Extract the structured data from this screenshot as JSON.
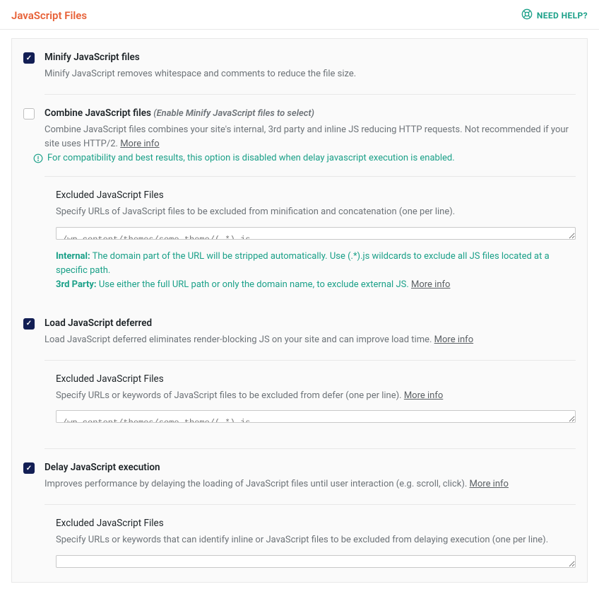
{
  "header": {
    "title": "JavaScript Files",
    "help_label": "NEED HELP?"
  },
  "minify": {
    "title": "Minify JavaScript files",
    "desc": "Minify JavaScript removes whitespace and comments to reduce the file size."
  },
  "combine": {
    "title": "Combine JavaScript files",
    "hint": "(Enable Minify JavaScript files to select)",
    "desc": "Combine JavaScript files combines your site's internal, 3rd party and inline JS reducing HTTP requests. Not recommended if your site uses HTTP/2.",
    "more": "More info",
    "warn": "For compatibility and best results, this option is disabled when delay javascript execution is enabled."
  },
  "excluded1": {
    "title": "Excluded JavaScript Files",
    "desc": "Specify URLs of JavaScript files to be excluded from minification and concatenation (one per line).",
    "placeholder": "/wp-content/themes/some-theme/(.*).js",
    "help_internal_label": "Internal:",
    "help_internal_text": "The domain part of the URL will be stripped automatically. Use (.*).js wildcards to exclude all JS files located at a specific path.",
    "help_third_label": "3rd Party:",
    "help_third_text": "Use either the full URL path or only the domain name, to exclude external JS.",
    "more": "More info"
  },
  "defer": {
    "title": "Load JavaScript deferred",
    "desc": "Load JavaScript deferred eliminates render-blocking JS on your site and can improve load time.",
    "more": "More info"
  },
  "excluded2": {
    "title": "Excluded JavaScript Files",
    "desc": "Specify URLs or keywords of JavaScript files to be excluded from defer (one per line).",
    "more": "More info",
    "placeholder": "/wp-content/themes/some-theme/(.*).js"
  },
  "delay": {
    "title": "Delay JavaScript execution",
    "desc": "Improves performance by delaying the loading of JavaScript files until user interaction (e.g. scroll, click).",
    "more": "More info"
  },
  "excluded3": {
    "title": "Excluded JavaScript Files",
    "desc": "Specify URLs or keywords that can identify inline or JavaScript files to be excluded from delaying execution (one per line).",
    "placeholder": ""
  }
}
